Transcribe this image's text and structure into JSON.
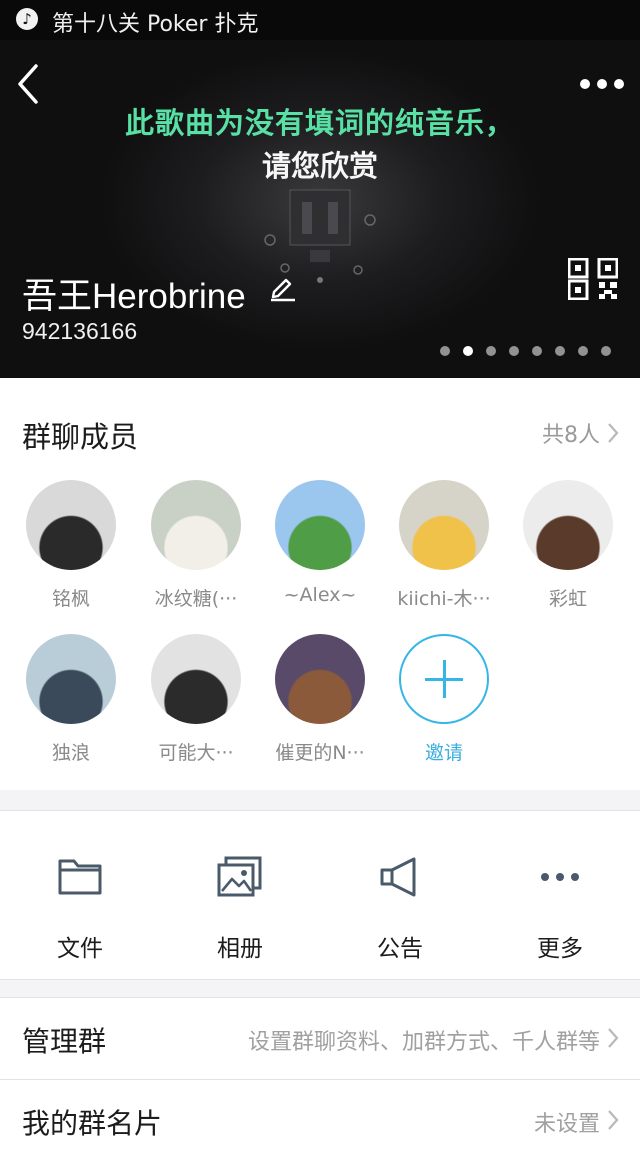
{
  "music": {
    "title": "第十八关 Poker 扑克"
  },
  "header": {
    "lyric_line1": "此歌曲为没有填词的纯音乐，",
    "lyric_line2": "请您欣赏",
    "group_name": "吾王Herobrine",
    "group_id": "942136166",
    "carousel": {
      "total": 8,
      "active": 1
    }
  },
  "members": {
    "title": "群聊成员",
    "count": "共8人",
    "list": [
      {
        "name": "铭枫",
        "avatar_colors": [
          "#d9d9d9",
          "#2a2a2a"
        ]
      },
      {
        "name": "冰纹糖(···",
        "avatar_colors": [
          "#c9d1c7",
          "#f1efe8"
        ]
      },
      {
        "name": "~Alex~",
        "avatar_colors": [
          "#9bc7ef",
          "#4f9e47"
        ]
      },
      {
        "name": "kiichi-木···",
        "avatar_colors": [
          "#d6d3c8",
          "#f0c24a"
        ]
      },
      {
        "name": "彩虹",
        "avatar_colors": [
          "#ececec",
          "#5a3a2a"
        ]
      },
      {
        "name": "独浪",
        "avatar_colors": [
          "#b9cdd8",
          "#3a4a5a"
        ]
      },
      {
        "name": "可能大···",
        "avatar_colors": [
          "#e2e2e2",
          "#2b2b2b"
        ]
      },
      {
        "name": "催更的N···",
        "avatar_colors": [
          "#5a4a6a",
          "#8a5a3a"
        ]
      }
    ],
    "invite_label": "邀请"
  },
  "actions": [
    {
      "label": "文件",
      "icon": "folder-icon"
    },
    {
      "label": "相册",
      "icon": "album-icon"
    },
    {
      "label": "公告",
      "icon": "megaphone-icon"
    },
    {
      "label": "更多",
      "icon": "more-dots-icon"
    }
  ],
  "settings": {
    "manage": {
      "title": "管理群",
      "value": "设置群聊资料、加群方式、千人群等"
    },
    "my_card": {
      "title": "我的群名片",
      "value": "未设置"
    }
  },
  "colors": {
    "accent": "#36b6e6",
    "lyric_green": "#59e0a5"
  }
}
